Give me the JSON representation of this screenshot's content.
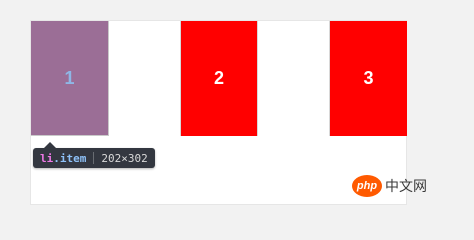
{
  "items": [
    {
      "label": "1"
    },
    {
      "label": "2"
    },
    {
      "label": "3"
    }
  ],
  "tooltip": {
    "tag": "li",
    "class": ".item",
    "dimensions": "202×302"
  },
  "watermark": {
    "badge": "php",
    "text": "中文网"
  },
  "colors": {
    "item_highlight": "#9b6e96",
    "item_red": "#ff0000",
    "tooltip_bg": "#333740",
    "logo_orange": "#ff5a00"
  }
}
